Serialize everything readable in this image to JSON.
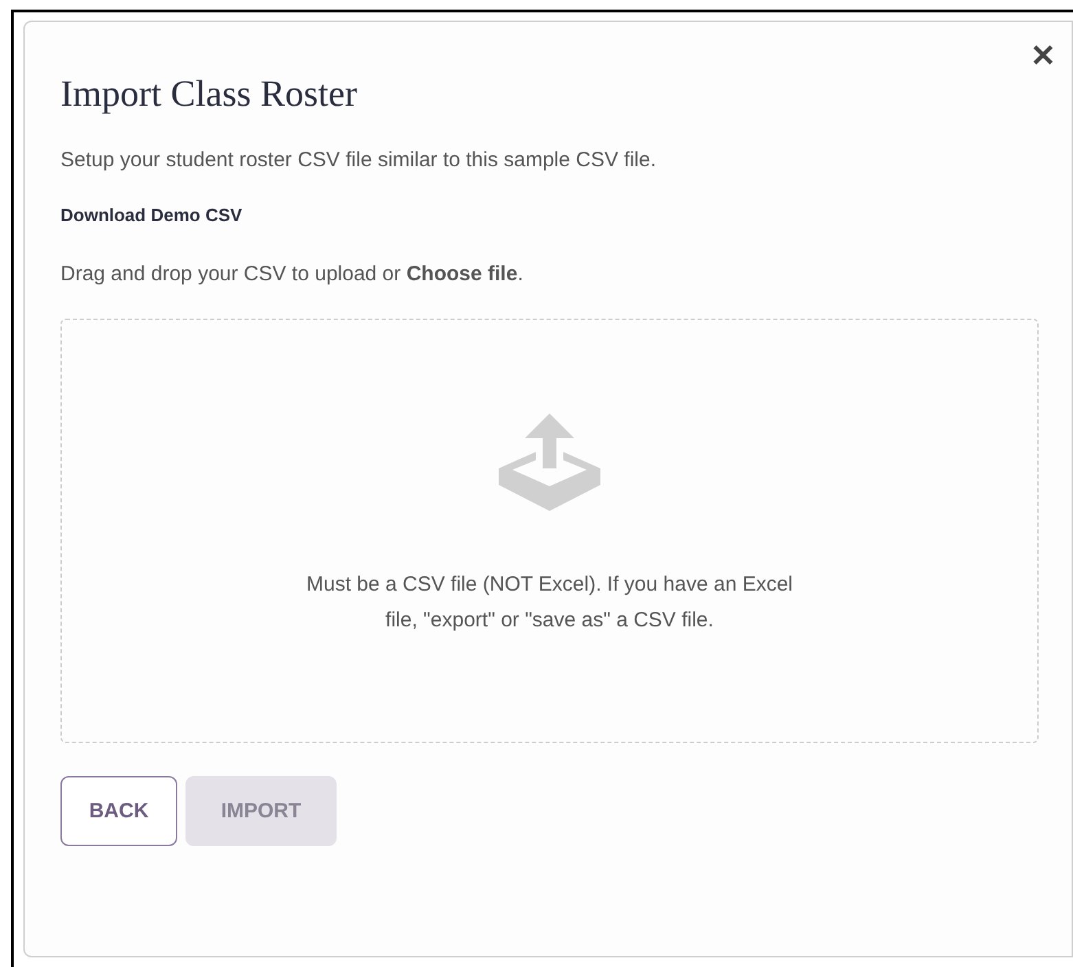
{
  "dialog": {
    "title": "Import Class Roster",
    "close": "✕"
  },
  "intro": "Setup your student roster CSV file similar to this sample CSV file.",
  "download_link": "Download Demo CSV",
  "instruction": "Drag and drop your CSV to upload or **Choose file**.",
  "dropzone": {
    "hint": "Must be a CSV file (NOT Excel). If you have an Excel file, \"export\" or \"save as\" a CSV file."
  },
  "buttons": [
    {
      "label": "BACK",
      "disabled": false
    },
    {
      "label": "IMPORT",
      "disabled": true
    }
  ]
}
